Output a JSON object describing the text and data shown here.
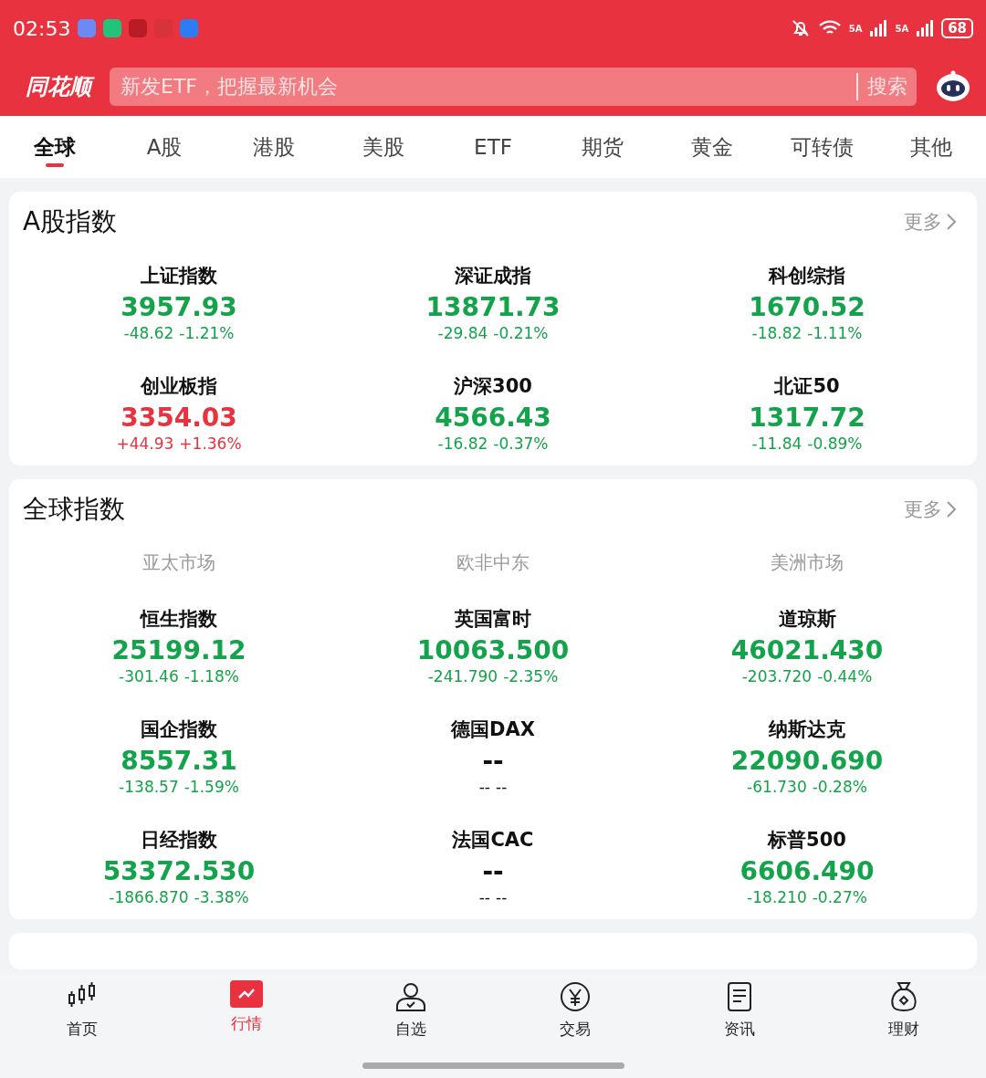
{
  "status_bar": {
    "time": "02:53",
    "network_1": "5A",
    "network_2": "5A",
    "battery": "68"
  },
  "header": {
    "logo": "同花顺",
    "search": {
      "placeholder": "新发ETF，把握最新机会",
      "button": "搜索"
    }
  },
  "tabs": [
    {
      "label": "全球",
      "selected": true
    },
    {
      "label": "A股",
      "selected": false
    },
    {
      "label": "港股",
      "selected": false
    },
    {
      "label": "美股",
      "selected": false
    },
    {
      "label": "ETF",
      "selected": false
    },
    {
      "label": "期货",
      "selected": false
    },
    {
      "label": "黄金",
      "selected": false
    },
    {
      "label": "可转债",
      "selected": false
    },
    {
      "label": "其他",
      "selected": false
    }
  ],
  "sections": [
    {
      "title": "A股指数",
      "more": "更多",
      "items": [
        {
          "name": "上证指数",
          "price": "3957.93",
          "change": "-48.62",
          "percent": "-1.21%",
          "color": "#13a34a"
        },
        {
          "name": "深证成指",
          "price": "13871.73",
          "change": "-29.84",
          "percent": "-0.21%",
          "color": "#13a34a"
        },
        {
          "name": "科创综指",
          "price": "1670.52",
          "change": "-18.82",
          "percent": "-1.11%",
          "color": "#13a34a"
        },
        {
          "name": "创业板指",
          "price": "3354.03",
          "change": "+44.93",
          "percent": "+1.36%",
          "color": "#e9323f"
        },
        {
          "name": "沪深300",
          "price": "4566.43",
          "change": "-16.82",
          "percent": "-0.37%",
          "color": "#13a34a"
        },
        {
          "name": "北证50",
          "price": "1317.72",
          "change": "-11.84",
          "percent": "-0.89%",
          "color": "#13a34a"
        }
      ]
    },
    {
      "title": "全球指数",
      "more": "更多",
      "regions": [
        "亚太市场",
        "欧非中东",
        "美洲市场"
      ],
      "items": [
        {
          "name": "恒生指数",
          "price": "25199.12",
          "change": "-301.46",
          "percent": "-1.18%",
          "color": "#13a34a"
        },
        {
          "name": "英国富时",
          "price": "10063.500",
          "change": "-241.790",
          "percent": "-2.35%",
          "color": "#13a34a"
        },
        {
          "name": "道琼斯",
          "price": "46021.430",
          "change": "-203.720",
          "percent": "-0.44%",
          "color": "#13a34a"
        },
        {
          "name": "国企指数",
          "price": "8557.31",
          "change": "-138.57",
          "percent": "-1.59%",
          "color": "#13a34a"
        },
        {
          "name": "德国DAX",
          "price": "--",
          "change": "--",
          "percent": "--",
          "color": "#111111"
        },
        {
          "name": "纳斯达克",
          "price": "22090.690",
          "change": "-61.730",
          "percent": "-0.28%",
          "color": "#13a34a"
        },
        {
          "name": "日经指数",
          "price": "53372.530",
          "change": "-1866.870",
          "percent": "-3.38%",
          "color": "#13a34a"
        },
        {
          "name": "法国CAC",
          "price": "--",
          "change": "--",
          "percent": "--",
          "color": "#111111"
        },
        {
          "name": "标普500",
          "price": "6606.490",
          "change": "-18.210",
          "percent": "-0.27%",
          "color": "#13a34a"
        }
      ]
    }
  ],
  "bottom_nav": [
    {
      "label": "首页",
      "kind": "candles",
      "selected": false
    },
    {
      "label": "行情",
      "kind": "chart",
      "selected": true
    },
    {
      "label": "自选",
      "kind": "person",
      "selected": false
    },
    {
      "label": "交易",
      "kind": "yen",
      "selected": false
    },
    {
      "label": "资讯",
      "kind": "doc",
      "selected": false
    },
    {
      "label": "理财",
      "kind": "bag",
      "selected": false
    }
  ]
}
